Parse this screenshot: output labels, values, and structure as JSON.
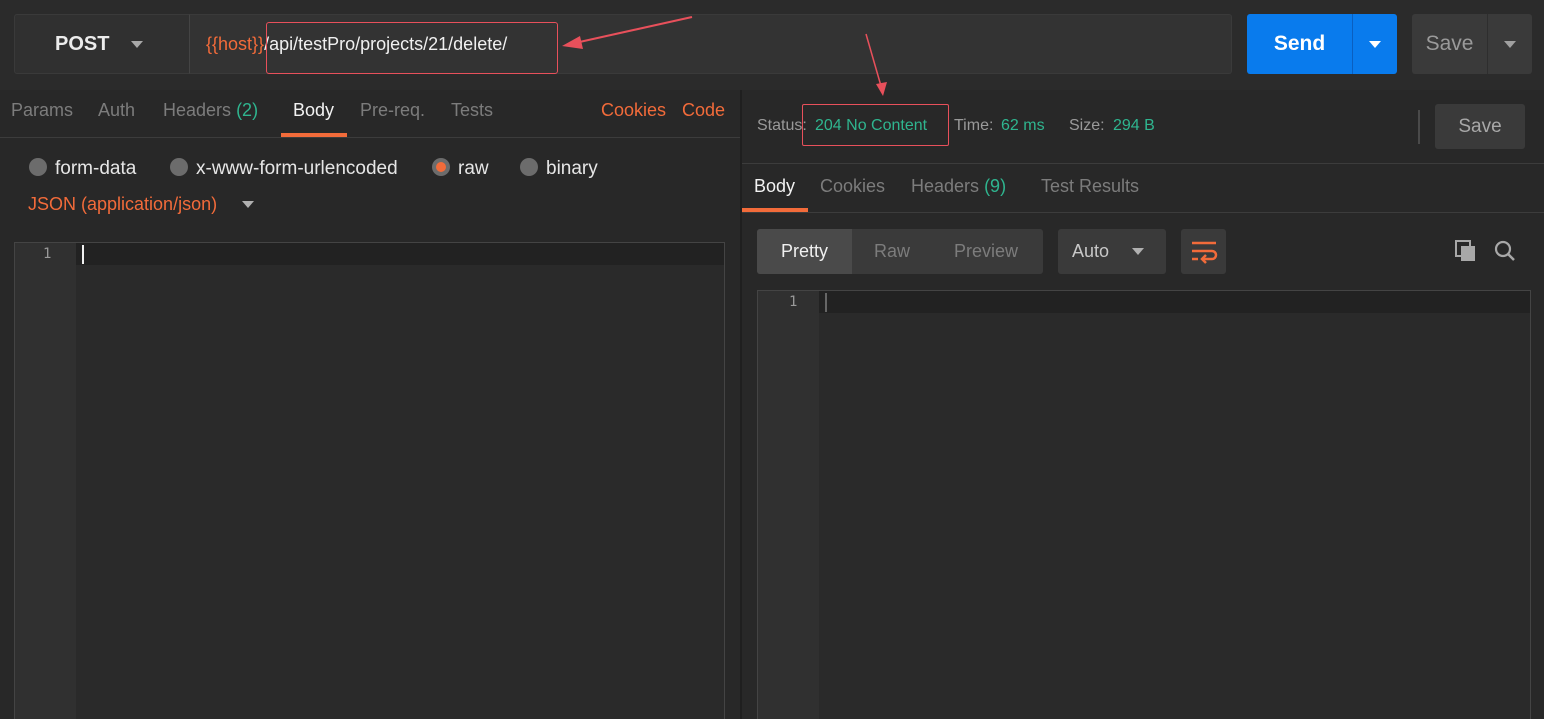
{
  "request": {
    "method": "POST",
    "url_host": "{{host}}",
    "url_path": "/api/testPro/projects/21/delete/",
    "send_label": "Send",
    "save_label": "Save"
  },
  "request_tabs": {
    "params": "Params",
    "auth": "Auth",
    "headers": "Headers",
    "headers_count": "(2)",
    "body": "Body",
    "prereq": "Pre-req.",
    "tests": "Tests",
    "cookies": "Cookies",
    "code": "Code"
  },
  "body_modes": {
    "form_data": "form-data",
    "urlencoded": "x-www-form-urlencoded",
    "raw": "raw",
    "binary": "binary",
    "selected": "raw",
    "content_type": "JSON (application/json)"
  },
  "editor_left": {
    "line_number": "1"
  },
  "response": {
    "status_label": "Status:",
    "status_value": "204 No Content",
    "time_label": "Time:",
    "time_value": "62 ms",
    "size_label": "Size:",
    "size_value": "294 B",
    "save_label": "Save"
  },
  "response_tabs": {
    "body": "Body",
    "cookies": "Cookies",
    "headers": "Headers",
    "headers_count": "(9)",
    "test_results": "Test Results"
  },
  "response_view": {
    "pretty": "Pretty",
    "raw": "Raw",
    "preview": "Preview",
    "format": "Auto"
  },
  "editor_right": {
    "line_number": "1"
  },
  "colors": {
    "accent": "#f26b3a",
    "send_blue": "#097bed",
    "success_green": "#2fb58f",
    "annotation_red": "#e8505b"
  }
}
